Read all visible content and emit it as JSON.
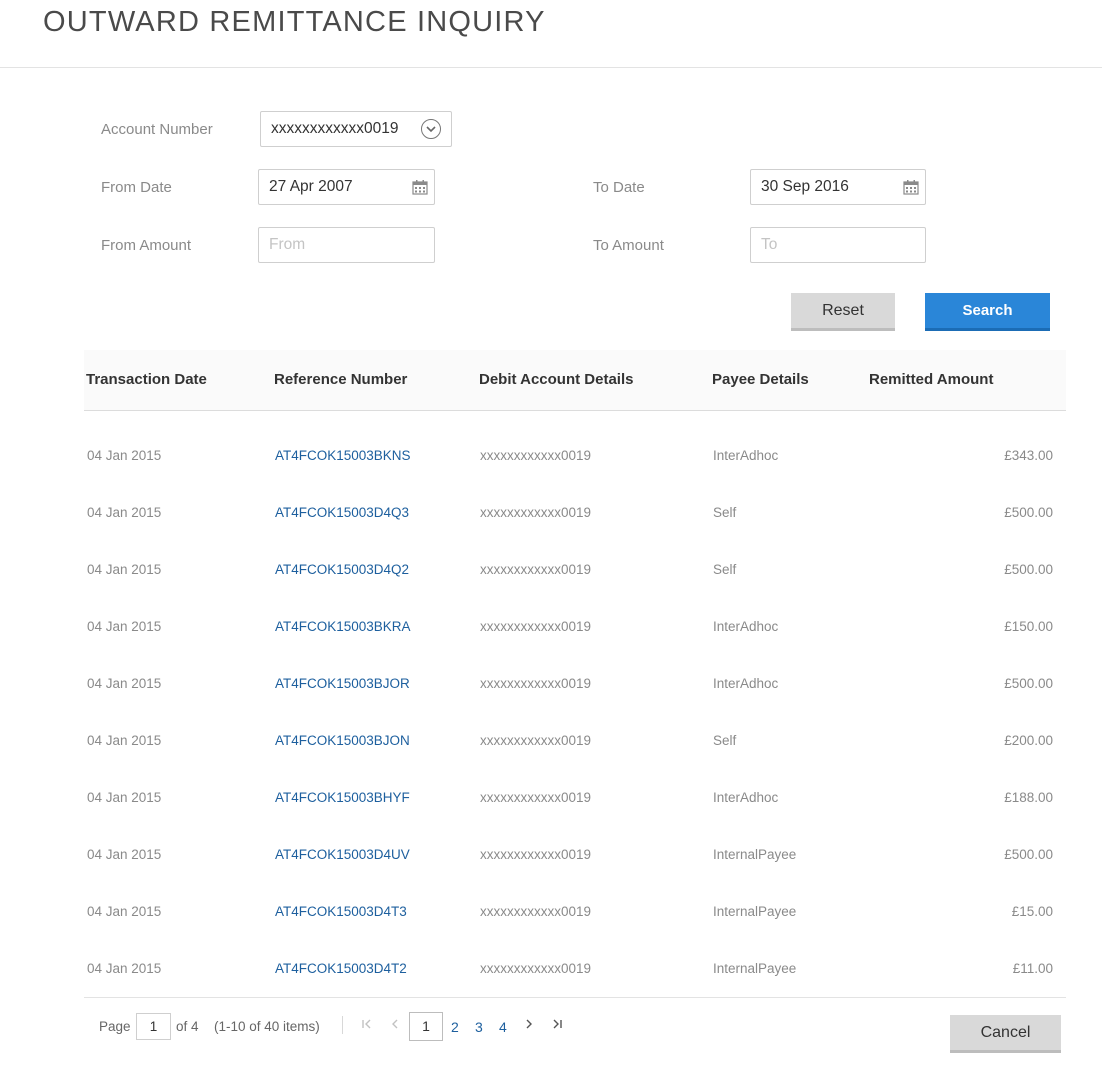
{
  "page": {
    "title": "OUTWARD REMITTANCE INQUIRY"
  },
  "form": {
    "account_number_label": "Account Number",
    "account_number_value": "xxxxxxxxxxxx0019",
    "from_date_label": "From Date",
    "from_date_value": "27 Apr 2007",
    "to_date_label": "To Date",
    "to_date_value": "30 Sep 2016",
    "from_amount_label": "From Amount",
    "from_amount_placeholder": "From",
    "to_amount_label": "To Amount",
    "to_amount_placeholder": "To"
  },
  "buttons": {
    "reset": "Reset",
    "search": "Search",
    "cancel": "Cancel"
  },
  "table": {
    "headers": [
      "Transaction Date",
      "Reference Number",
      "Debit Account Details",
      "Payee Details",
      "Remitted Amount"
    ],
    "rows": [
      {
        "date": "04 Jan 2015",
        "ref": "AT4FCOK15003BKNS",
        "account": "xxxxxxxxxxxx0019",
        "payee": "InterAdhoc",
        "amount": "£343.00"
      },
      {
        "date": "04 Jan 2015",
        "ref": "AT4FCOK15003D4Q3",
        "account": "xxxxxxxxxxxx0019",
        "payee": "Self",
        "amount": "£500.00"
      },
      {
        "date": "04 Jan 2015",
        "ref": "AT4FCOK15003D4Q2",
        "account": "xxxxxxxxxxxx0019",
        "payee": "Self",
        "amount": "£500.00"
      },
      {
        "date": "04 Jan 2015",
        "ref": "AT4FCOK15003BKRA",
        "account": "xxxxxxxxxxxx0019",
        "payee": "InterAdhoc",
        "amount": "£150.00"
      },
      {
        "date": "04 Jan 2015",
        "ref": "AT4FCOK15003BJOR",
        "account": "xxxxxxxxxxxx0019",
        "payee": "InterAdhoc",
        "amount": "£500.00"
      },
      {
        "date": "04 Jan 2015",
        "ref": "AT4FCOK15003BJON",
        "account": "xxxxxxxxxxxx0019",
        "payee": "Self",
        "amount": "£200.00"
      },
      {
        "date": "04 Jan 2015",
        "ref": "AT4FCOK15003BHYF",
        "account": "xxxxxxxxxxxx0019",
        "payee": "InterAdhoc",
        "amount": "£188.00"
      },
      {
        "date": "04 Jan 2015",
        "ref": "AT4FCOK15003D4UV",
        "account": "xxxxxxxxxxxx0019",
        "payee": "InternalPayee",
        "amount": "£500.00"
      },
      {
        "date": "04 Jan 2015",
        "ref": "AT4FCOK15003D4T3",
        "account": "xxxxxxxxxxxx0019",
        "payee": "InternalPayee",
        "amount": "£15.00"
      },
      {
        "date": "04 Jan 2015",
        "ref": "AT4FCOK15003D4T2",
        "account": "xxxxxxxxxxxx0019",
        "payee": "InternalPayee",
        "amount": "£11.00"
      }
    ]
  },
  "pagination": {
    "page_label": "Page",
    "page_value": "1",
    "of_label": "of 4",
    "range_label": "(1-10 of 40 items)",
    "current_page": "1",
    "pages": [
      "2",
      "3",
      "4"
    ]
  },
  "icons": {
    "first": "first-page-icon",
    "prev": "previous-page-icon",
    "next": "next-page-icon",
    "last": "last-page-icon",
    "calendar": "calendar-icon",
    "chevron": "chevron-down-icon"
  },
  "colors": {
    "accent": "#2a86d8",
    "link": "#1d5f9e"
  }
}
